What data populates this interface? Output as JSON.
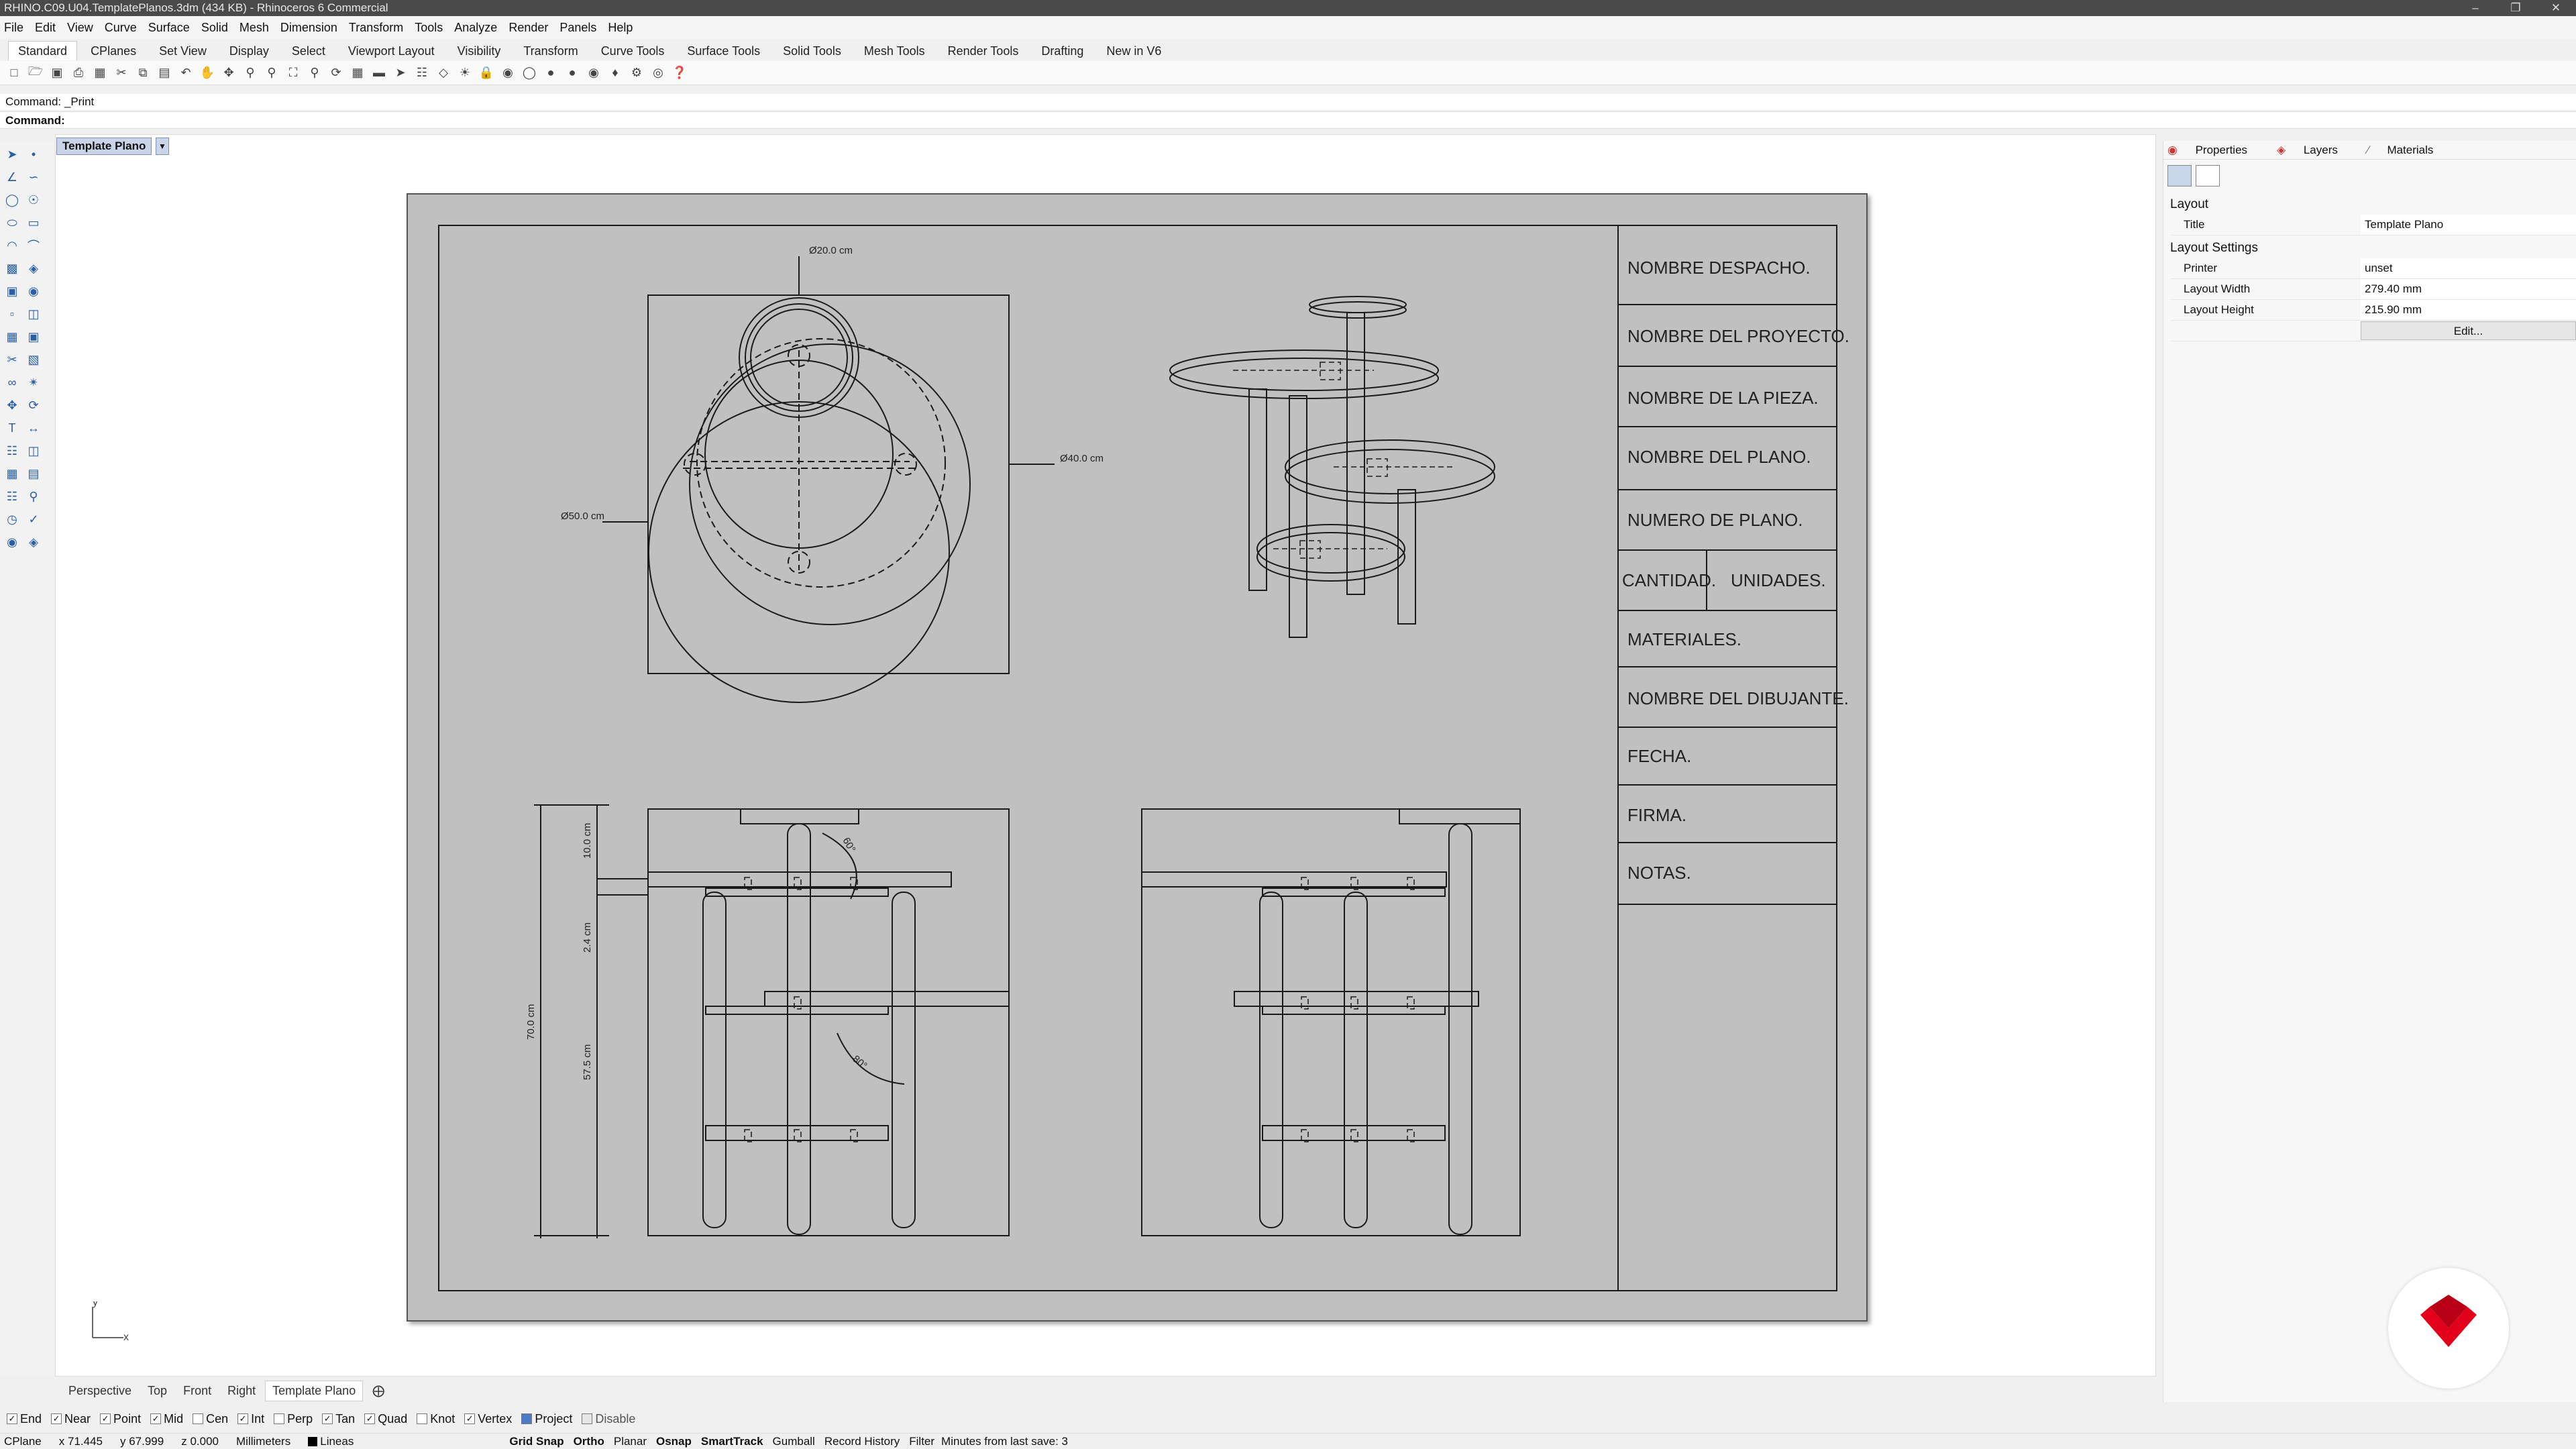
{
  "window": {
    "title": "RHINO.C09.U04.TemplatePlanos.3dm (434 KB) - Rhinoceros 6 Commercial"
  },
  "menu": [
    "File",
    "Edit",
    "View",
    "Curve",
    "Surface",
    "Solid",
    "Mesh",
    "Dimension",
    "Transform",
    "Tools",
    "Analyze",
    "Render",
    "Panels",
    "Help"
  ],
  "tabs": [
    "Standard",
    "CPlanes",
    "Set View",
    "Display",
    "Select",
    "Viewport Layout",
    "Visibility",
    "Transform",
    "Curve Tools",
    "Surface Tools",
    "Solid Tools",
    "Mesh Tools",
    "Render Tools",
    "Drafting",
    "New in V6"
  ],
  "command": {
    "history": "Command: _Print",
    "prompt": "Command:"
  },
  "viewport": {
    "title": "Template Plano"
  },
  "drawing": {
    "dims": {
      "d20": "Ø20.0 cm",
      "d40": "Ø40.0 cm",
      "d50": "Ø50.0 cm",
      "h10": "10.0 cm",
      "h24": "2.4 cm",
      "h70": "70.0 cm",
      "h575": "57.5 cm",
      "a60": "60°",
      "a80": "80°"
    },
    "title_block": {
      "despacho": "NOMBRE DESPACHO.",
      "proyecto": "NOMBRE DEL PROYECTO.",
      "pieza": "NOMBRE DE LA PIEZA.",
      "plano": "NOMBRE DEL PLANO.",
      "numero": "NUMERO DE PLANO.",
      "cantidad": "CANTIDAD.",
      "unidades": "UNIDADES.",
      "materiales": "MATERIALES.",
      "dibujante": "NOMBRE DEL DIBUJANTE.",
      "fecha": "FECHA.",
      "firma": "FIRMA.",
      "notas": "NOTAS."
    }
  },
  "axes": {
    "y": "y",
    "x": "x"
  },
  "view_tabs": [
    "Perspective",
    "Top",
    "Front",
    "Right",
    "Template Plano"
  ],
  "panel": {
    "tabs": [
      "Properties",
      "Layers",
      "Materials"
    ],
    "layout_header": "Layout",
    "title_label": "Title",
    "title_value": "Template Plano",
    "settings_header": "Layout Settings",
    "printer_label": "Printer",
    "printer_value": "unset",
    "width_label": "Layout Width",
    "width_value": "279.40 mm",
    "height_label": "Layout Height",
    "height_value": "215.90 mm",
    "edit_button": "Edit..."
  },
  "osnap": [
    {
      "label": "End",
      "checked": true
    },
    {
      "label": "Near",
      "checked": true
    },
    {
      "label": "Point",
      "checked": true
    },
    {
      "label": "Mid",
      "checked": true
    },
    {
      "label": "Cen",
      "checked": false
    },
    {
      "label": "Int",
      "checked": true
    },
    {
      "label": "Perp",
      "checked": false
    },
    {
      "label": "Tan",
      "checked": true
    },
    {
      "label": "Quad",
      "checked": true
    },
    {
      "label": "Knot",
      "checked": false
    },
    {
      "label": "Vertex",
      "checked": true
    },
    {
      "label": "Project",
      "checked": true
    },
    {
      "label": "Disable",
      "checked": false
    }
  ],
  "status": {
    "cplane": "CPlane",
    "x": "x 71.445",
    "y": "y 67.999",
    "z": "z 0.000",
    "units": "Millimeters",
    "layer": "Lineas",
    "toggles": [
      "Grid Snap",
      "Ortho",
      "Planar",
      "Osnap",
      "SmartTrack",
      "Gumball",
      "Record History",
      "Filter"
    ],
    "save_info": "Minutes from last save: 3"
  },
  "colors": {
    "sheet": "#c0c0c0",
    "logo": "#e3001b",
    "accent": "#2a5fa8"
  }
}
